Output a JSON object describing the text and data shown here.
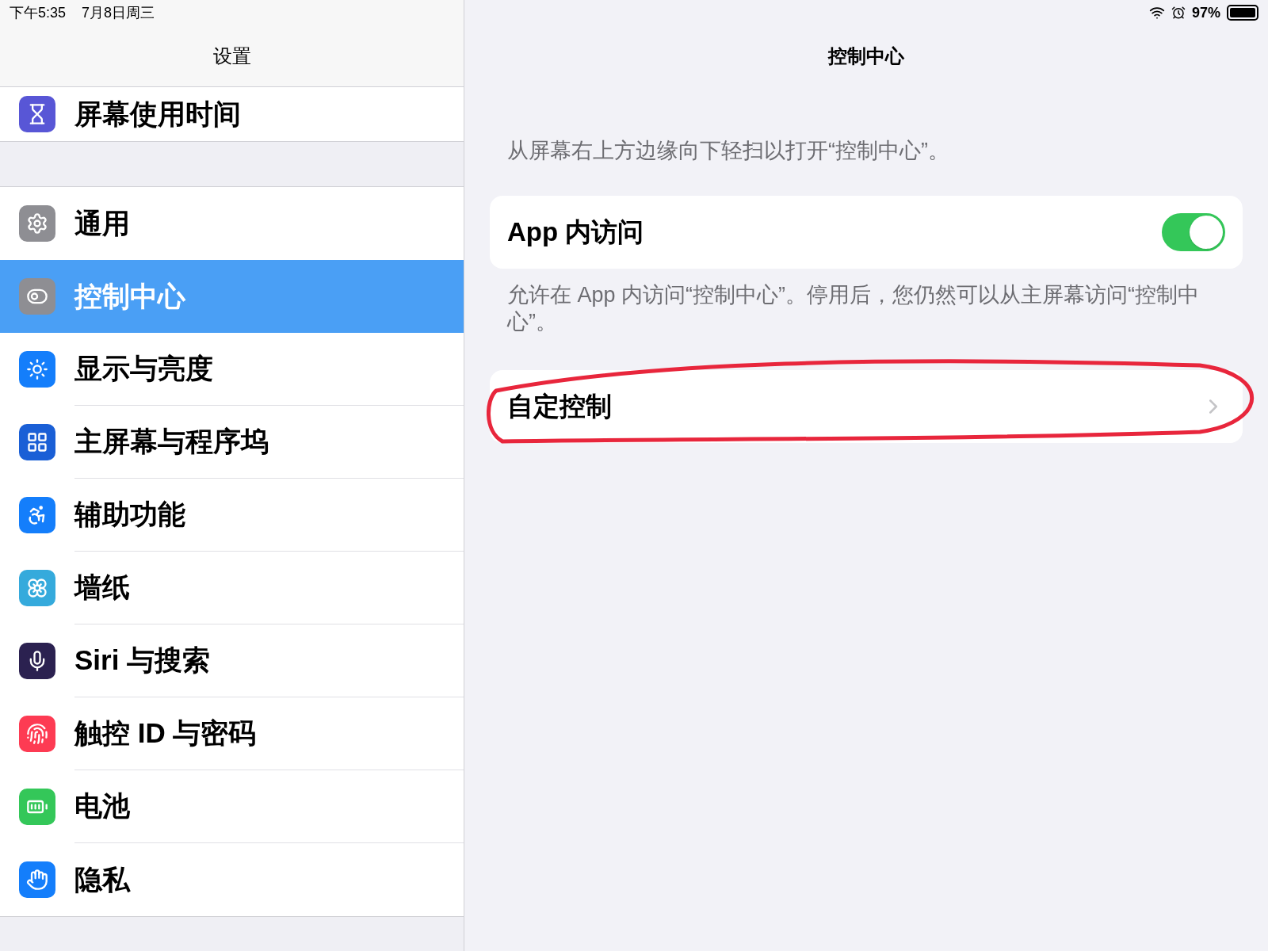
{
  "status_bar": {
    "time": "下午5:35",
    "date": "7月8日周三",
    "battery": "97%"
  },
  "sidebar": {
    "title": "设置",
    "groups": [
      {
        "items": [
          {
            "label": "屏幕使用时间",
            "selected": false
          }
        ]
      },
      {
        "items": [
          {
            "label": "通用",
            "selected": false
          },
          {
            "label": "控制中心",
            "selected": true
          },
          {
            "label": "显示与亮度",
            "selected": false
          },
          {
            "label": "主屏幕与程序坞",
            "selected": false
          },
          {
            "label": "辅助功能",
            "selected": false
          },
          {
            "label": "墙纸",
            "selected": false
          },
          {
            "label": "Siri 与搜索",
            "selected": false
          },
          {
            "label": "触控 ID 与密码",
            "selected": false
          },
          {
            "label": "电池",
            "selected": false
          },
          {
            "label": "隐私",
            "selected": false
          }
        ]
      }
    ]
  },
  "detail": {
    "title": "控制中心",
    "hint": "从屏幕右上方边缘向下轻扫以打开“控制中心”。",
    "toggle_row": {
      "label": "App 内访问",
      "on": true
    },
    "footer": "允许在 App 内访问“控制中心”。停用后，您仍然可以从主屏幕访问“控制中心”。",
    "link_row": {
      "label": "自定控制"
    }
  }
}
